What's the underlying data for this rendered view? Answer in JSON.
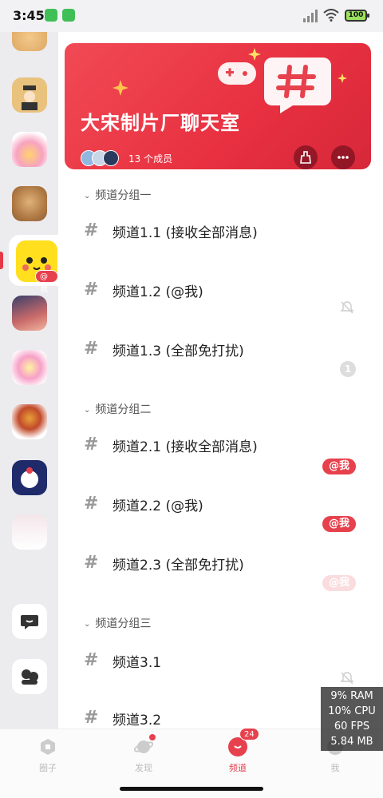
{
  "status_bar": {
    "time": "3:45",
    "battery": "100"
  },
  "group": {
    "title": "大宋制片厂聊天室",
    "members": "13 个成员",
    "rail_badge": "@我"
  },
  "channel_groups": [
    {
      "title": "频道分组一",
      "channels": [
        {
          "name": "频道1.1 (接收全部消息)",
          "indicator": ""
        },
        {
          "name": "频道1.2 (@我)",
          "indicator": "bell-off"
        },
        {
          "name": "频道1.3 (全部免打扰)",
          "indicator": "1"
        }
      ]
    },
    {
      "title": "频道分组二",
      "channels": [
        {
          "name": "频道2.1 (接收全部消息)",
          "indicator": "@我"
        },
        {
          "name": "频道2.2 (@我)",
          "indicator": "@我"
        },
        {
          "name": "频道2.3 (全部免打扰)",
          "indicator": "@我"
        }
      ]
    },
    {
      "title": "频道分组三",
      "channels": [
        {
          "name": "频道3.1",
          "indicator": "bell-off"
        },
        {
          "name": "频道3.2",
          "indicator": ""
        }
      ]
    }
  ],
  "bottom_nav": [
    {
      "label": "圈子",
      "icon": "circle-hex-icon"
    },
    {
      "label": "发现",
      "icon": "planet-icon"
    },
    {
      "label": "频道",
      "icon": "channel-icon",
      "count": "24"
    },
    {
      "label": "我",
      "icon": "profile-icon"
    }
  ],
  "perf_overlay": {
    "ram": "9% RAM",
    "cpu": "10% CPU",
    "fps": "60 FPS",
    "mem": "5.84 MB"
  },
  "colors": {
    "accent": "#e6414d",
    "header": "#ee3f4b"
  }
}
